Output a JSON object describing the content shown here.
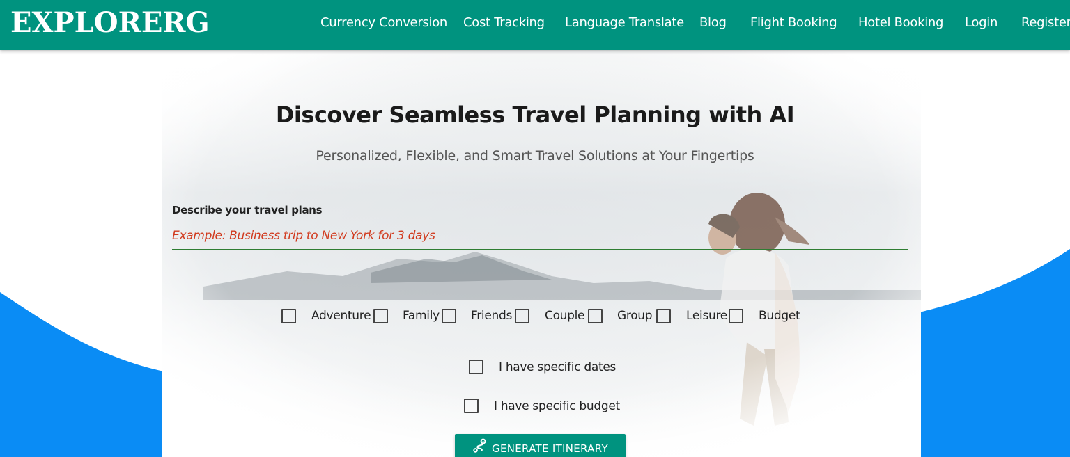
{
  "header": {
    "logo": "EXPLORERG",
    "nav": [
      {
        "label": "Currency Conversion"
      },
      {
        "label": "Cost Tracking"
      },
      {
        "label": "Language Translate"
      },
      {
        "label": "Blog"
      },
      {
        "label": "Flight Booking"
      },
      {
        "label": "Hotel Booking"
      },
      {
        "label": "Login"
      },
      {
        "label": "Register"
      }
    ]
  },
  "hero": {
    "title": "Discover Seamless Travel Planning with AI",
    "subtitle": "Personalized, Flexible, and Smart Travel Solutions at Your Fingertips"
  },
  "form": {
    "plans_label": "Describe your travel plans",
    "plans_value": "",
    "plans_placeholder": "Example: Business trip to New York for 3 days",
    "trip_types": [
      {
        "label": "Adventure",
        "checked": false
      },
      {
        "label": "Family",
        "checked": false
      },
      {
        "label": "Friends",
        "checked": false
      },
      {
        "label": "Couple",
        "checked": false
      },
      {
        "label": "Group",
        "checked": false
      },
      {
        "label": "Leisure",
        "checked": false
      },
      {
        "label": "Budget",
        "checked": false
      }
    ],
    "specific_dates_label": "I have specific dates",
    "specific_dates_checked": false,
    "specific_budget_label": "I have specific budget",
    "specific_budget_checked": false,
    "generate_label": "GENERATE ITINERARY",
    "generate_icon": "route-icon"
  },
  "colors": {
    "header_bg": "#00937f",
    "accent_blue": "#0a8cf5",
    "input_underline": "#2e7d32",
    "placeholder": "#d13a1e"
  }
}
